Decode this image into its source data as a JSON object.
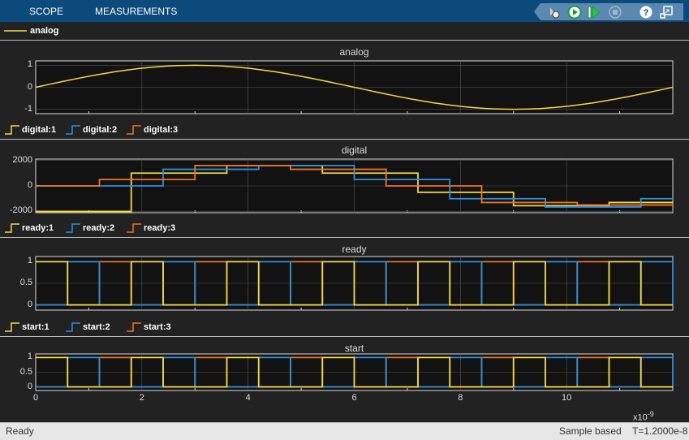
{
  "tabs": [
    "SCOPE",
    "MEASUREMENTS"
  ],
  "toolbar": {
    "icons": [
      "settings-icon",
      "run-icon",
      "step-forward-icon",
      "stop-icon",
      "help-icon",
      "undock-icon"
    ]
  },
  "colors": {
    "yellow": "#f5d843",
    "blue": "#2c8fe0",
    "orange": "#f07321",
    "axes_bg": "#121212",
    "grid": "#555"
  },
  "panels": [
    {
      "title": "analog",
      "legend": [
        "analog"
      ],
      "yticks": [
        "1",
        "0",
        "-1"
      ],
      "ylim": [
        -1.2,
        1.2
      ],
      "yvals": [
        1,
        0,
        -1
      ]
    },
    {
      "title": "digital",
      "legend": [
        "digital:1",
        "digital:2",
        "digital:3"
      ],
      "yticks": [
        "2000",
        "0",
        "-2000"
      ],
      "ylim": [
        -2100,
        2100
      ],
      "yvals": [
        2000,
        0,
        -2000
      ]
    },
    {
      "title": "ready",
      "legend": [
        "ready:1",
        "ready:2",
        "ready:3"
      ],
      "yticks": [
        "1",
        "0.5",
        "0"
      ],
      "ylim": [
        -0.12,
        1.12
      ],
      "yvals": [
        1,
        0.5,
        0
      ]
    },
    {
      "title": "start",
      "legend": [
        "start:1",
        "start:2",
        "start:3"
      ],
      "yticks": [
        "1",
        "0.5",
        "0"
      ],
      "ylim": [
        -0.12,
        1.12
      ],
      "yvals": [
        1,
        0.5,
        0
      ]
    }
  ],
  "xaxis": {
    "ticks": [
      "0",
      "2",
      "4",
      "6",
      "8",
      "10"
    ],
    "tickvals": [
      0,
      2,
      4,
      6,
      8,
      10
    ],
    "range": [
      0,
      12
    ],
    "multiplier": "x10",
    "exponent": "-9"
  },
  "chart_data": {
    "type": "line",
    "analog": {
      "function": "sin(2*pi*t/12)",
      "tmax": 12
    },
    "digital": [
      {
        "name": "digital:1",
        "t": [
          0,
          1.8,
          3.6,
          5.4,
          7.2,
          9.0,
          10.8,
          12
        ],
        "v": [
          -2000,
          1000,
          1600,
          1000,
          -500,
          -1550,
          -1300,
          -1300
        ]
      },
      {
        "name": "digital:2",
        "t": [
          0,
          2.4,
          4.2,
          6.0,
          7.8,
          9.6,
          11.4,
          12
        ],
        "v": [
          0,
          1300,
          1600,
          500,
          -1000,
          -1650,
          -1000,
          -1000
        ]
      },
      {
        "name": "digital:3",
        "t": [
          0,
          1.2,
          3.0,
          4.8,
          6.6,
          8.4,
          10.2,
          12
        ],
        "v": [
          0,
          500,
          1600,
          1300,
          0,
          -1300,
          -1500,
          -1500
        ]
      }
    ],
    "square": {
      "period": 1.8,
      "high": 0.6,
      "offsets": [
        0,
        0.6,
        1.2
      ]
    }
  },
  "status": {
    "left": "Ready",
    "mode": "Sample based",
    "time": "T=1.2000e-8"
  }
}
